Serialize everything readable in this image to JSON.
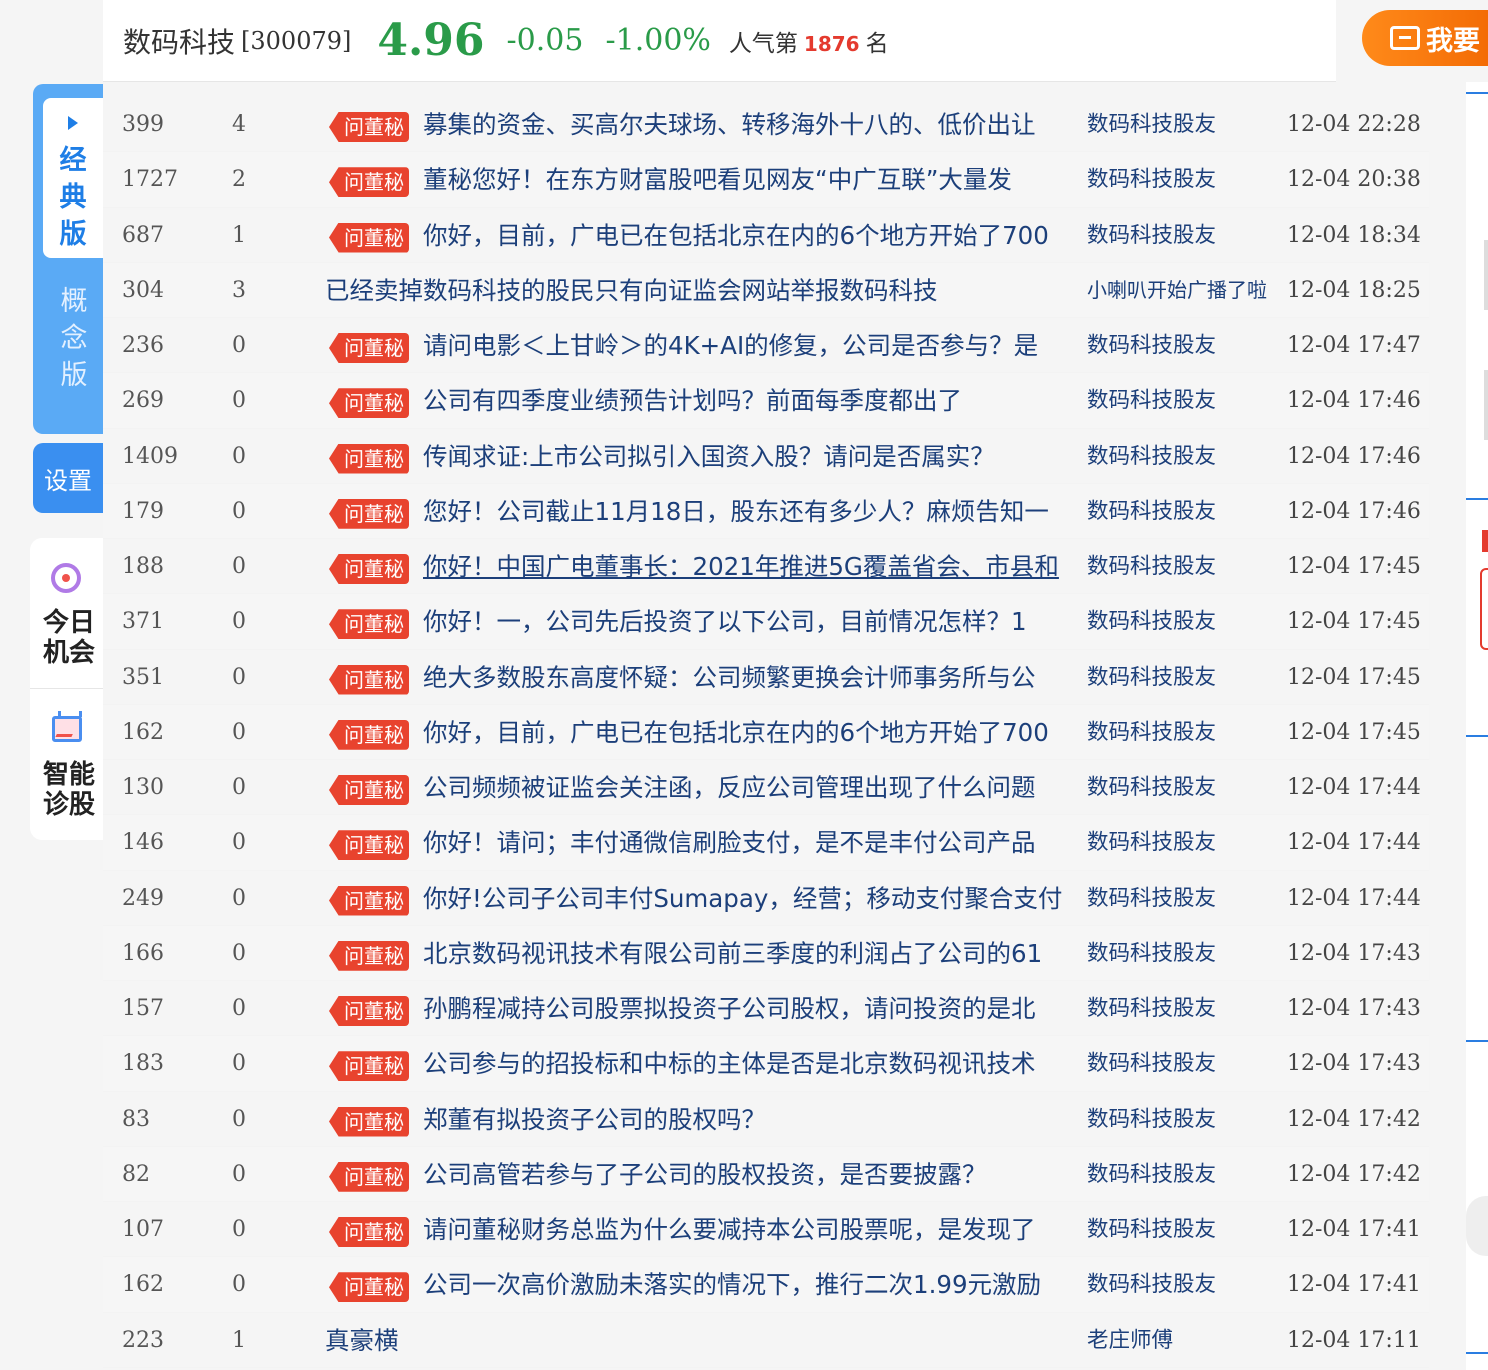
{
  "header": {
    "stock_name": "数码科技",
    "stock_code": "[300079]",
    "price": "4.96",
    "change": "-0.05",
    "change_pct": "-1.00%",
    "popularity_prefix": "人气第",
    "popularity_rank": "1876",
    "popularity_suffix": "名",
    "ask_button_label": "我要",
    "colors": {
      "down": "#2a9b49",
      "accent": "#f06400",
      "rank": "#e43a2e"
    }
  },
  "sidebar": {
    "tab_classic": "经典版",
    "tab_concept": "概念版",
    "settings": "设置",
    "today_chance": "今日机会",
    "smart_diagnosis": "智能诊股"
  },
  "tag_label": "问董秘",
  "posts": [
    {
      "views": "399",
      "replies": "4",
      "tag": true,
      "title": "募集的资金、买高尔夫球场、转移海外十八的、低价出让",
      "author": "数码科技股友",
      "time": "12-04 22:28"
    },
    {
      "views": "1727",
      "replies": "2",
      "tag": true,
      "title": "董秘您好！在东方财富股吧看见网友“中广互联”大量发",
      "author": "数码科技股友",
      "time": "12-04 20:38"
    },
    {
      "views": "687",
      "replies": "1",
      "tag": true,
      "title": "你好，目前，广电已在包括北京在内的6个地方开始了700",
      "author": "数码科技股友",
      "time": "12-04 18:34"
    },
    {
      "views": "304",
      "replies": "3",
      "tag": false,
      "title": "已经卖掉数码科技的股民只有向证监会网站举报数码科技",
      "author": "小喇叭开始广播了啦",
      "time": "12-04 18:25"
    },
    {
      "views": "236",
      "replies": "0",
      "tag": true,
      "title": "请问电影＜上甘岭＞的4K+AI的修复，公司是否参与？是",
      "author": "数码科技股友",
      "time": "12-04 17:47"
    },
    {
      "views": "269",
      "replies": "0",
      "tag": true,
      "title": "公司有四季度业绩预告计划吗？前面每季度都出了",
      "author": "数码科技股友",
      "time": "12-04 17:46"
    },
    {
      "views": "1409",
      "replies": "0",
      "tag": true,
      "title": "传闻求证:上市公司拟引入国资入股？请问是否属实？",
      "author": "数码科技股友",
      "time": "12-04 17:46"
    },
    {
      "views": "179",
      "replies": "0",
      "tag": true,
      "title": "您好！公司截止11月18日，股东还有多少人？麻烦告知一",
      "author": "数码科技股友",
      "time": "12-04 17:46"
    },
    {
      "views": "188",
      "replies": "0",
      "tag": true,
      "underline": true,
      "title": "你好！中国广电董事长：2021年推进5G覆盖省会、市县和",
      "author": "数码科技股友",
      "time": "12-04 17:45"
    },
    {
      "views": "371",
      "replies": "0",
      "tag": true,
      "title": "你好！一，公司先后投资了以下公司，目前情况怎样？1",
      "author": "数码科技股友",
      "time": "12-04 17:45"
    },
    {
      "views": "351",
      "replies": "0",
      "tag": true,
      "title": "绝大多数股东高度怀疑：公司频繁更换会计师事务所与公",
      "author": "数码科技股友",
      "time": "12-04 17:45"
    },
    {
      "views": "162",
      "replies": "0",
      "tag": true,
      "title": "你好，目前，广电已在包括北京在内的6个地方开始了700",
      "author": "数码科技股友",
      "time": "12-04 17:45"
    },
    {
      "views": "130",
      "replies": "0",
      "tag": true,
      "title": "公司频频被证监会关注函，反应公司管理出现了什么问题",
      "author": "数码科技股友",
      "time": "12-04 17:44"
    },
    {
      "views": "146",
      "replies": "0",
      "tag": true,
      "title": "你好！请问；丰付通微信刷脸支付，是不是丰付公司产品",
      "author": "数码科技股友",
      "time": "12-04 17:44"
    },
    {
      "views": "249",
      "replies": "0",
      "tag": true,
      "title": "你好!公司子公司丰付Sumapay，经营；移动支付聚合支付",
      "author": "数码科技股友",
      "time": "12-04 17:44"
    },
    {
      "views": "166",
      "replies": "0",
      "tag": true,
      "title": "北京数码视讯技术有限公司前三季度的利润占了公司的61",
      "author": "数码科技股友",
      "time": "12-04 17:43"
    },
    {
      "views": "157",
      "replies": "0",
      "tag": true,
      "title": "孙鹏程减持公司股票拟投资子公司股权，请问投资的是北",
      "author": "数码科技股友",
      "time": "12-04 17:43"
    },
    {
      "views": "183",
      "replies": "0",
      "tag": true,
      "title": "公司参与的招投标和中标的主体是否是北京数码视讯技术",
      "author": "数码科技股友",
      "time": "12-04 17:43"
    },
    {
      "views": "83",
      "replies": "0",
      "tag": true,
      "title": "郑董有拟投资子公司的股权吗？",
      "author": "数码科技股友",
      "time": "12-04 17:42"
    },
    {
      "views": "82",
      "replies": "0",
      "tag": true,
      "title": "公司高管若参与了子公司的股权投资，是否要披露？",
      "author": "数码科技股友",
      "time": "12-04 17:42"
    },
    {
      "views": "107",
      "replies": "0",
      "tag": true,
      "title": "请问董秘财务总监为什么要减持本公司股票呢，是发现了",
      "author": "数码科技股友",
      "time": "12-04 17:41"
    },
    {
      "views": "162",
      "replies": "0",
      "tag": true,
      "title": "公司一次高价激励未落实的情况下，推行二次1.99元激励",
      "author": "数码科技股友",
      "time": "12-04 17:41"
    },
    {
      "views": "223",
      "replies": "1",
      "tag": false,
      "title": "真豪横",
      "author": "老庄师傅",
      "time": "12-04 17:11"
    }
  ]
}
